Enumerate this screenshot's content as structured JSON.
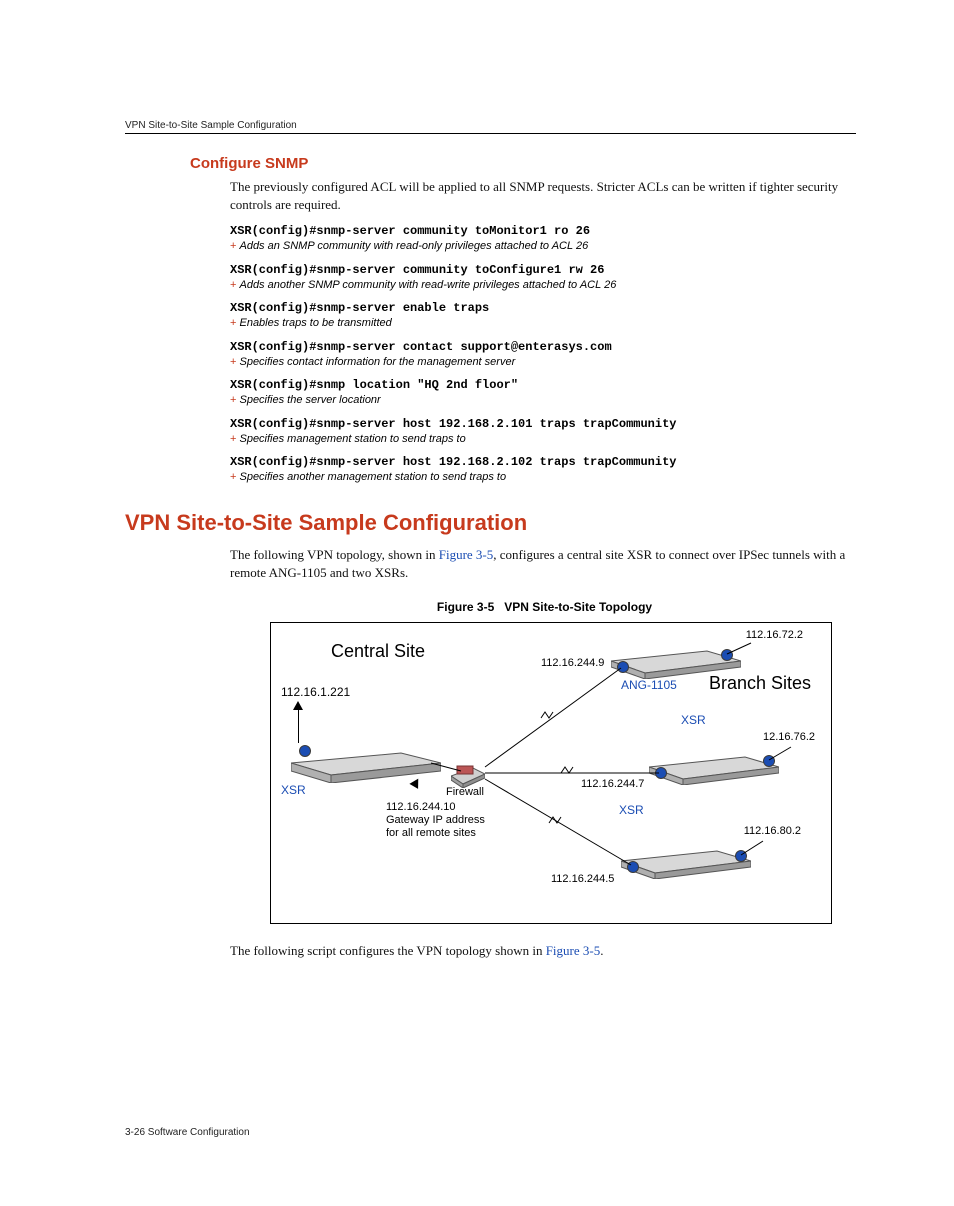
{
  "running_head": "VPN Site-to-Site Sample Configuration",
  "h3": "Configure SNMP",
  "intro": "The previously configured ACL will be applied to all SNMP requests. Stricter ACLs can be written if tighter security controls are required.",
  "cmds": [
    {
      "cmd": "XSR(config)#snmp-server community toMonitor1 ro 26",
      "note": "Adds an SNMP community with read-only privileges attached to ACL 26"
    },
    {
      "cmd": "XSR(config)#snmp-server community toConfigure1 rw 26",
      "note": "Adds another SNMP community with read-write privileges attached to ACL 26"
    },
    {
      "cmd": "XSR(config)#snmp-server enable traps",
      "note": "Enables traps to be transmitted"
    },
    {
      "cmd": "XSR(config)#snmp-server contact support@enterasys.com",
      "note": "Specifies contact information for the management server"
    },
    {
      "cmd": "XSR(config)#snmp location \"HQ 2nd floor\"",
      "note": "Specifies the server locationr"
    },
    {
      "cmd": "XSR(config)#snmp-server host 192.168.2.101 traps trapCommunity",
      "note": "Specifies management station to send traps to"
    },
    {
      "cmd": "XSR(config)#snmp-server host 192.168.2.102 traps trapCommunity",
      "note": "Specifies another management station to send traps to"
    }
  ],
  "h1": "VPN Site-to-Site Sample Configuration",
  "p1a": "The following VPN topology, shown in ",
  "p1link": "Figure 3-5",
  "p1b": ", configures a central site XSR to connect over IPSec tunnels with a remote ANG-1105 and two XSRs.",
  "fig_caption_num": "Figure 3-5",
  "fig_caption_title": "VPN Site-to-Site Topology",
  "fig": {
    "central_site": "Central Site",
    "branch_sites": "Branch Sites",
    "ip_central": "112.16.1.221",
    "ip_gw": "112.16.244.10",
    "gw_line2": "Gateway IP address",
    "gw_line3": "for all remote sites",
    "firewall": "Firewall",
    "ang": "ANG-1105",
    "xsr": "XSR",
    "ip_2449": "112.16.244.9",
    "ip_722": "112.16.72.2",
    "ip_2447": "112.16.244.7",
    "ip_762": "12.16.76.2",
    "ip_2445": "112.16.244.5",
    "ip_802": "112.16.80.2"
  },
  "p2a": "The following script configures the VPN topology shown in ",
  "p2link": "Figure 3-5",
  "p2b": ".",
  "footer": "3-26   Software Configuration"
}
